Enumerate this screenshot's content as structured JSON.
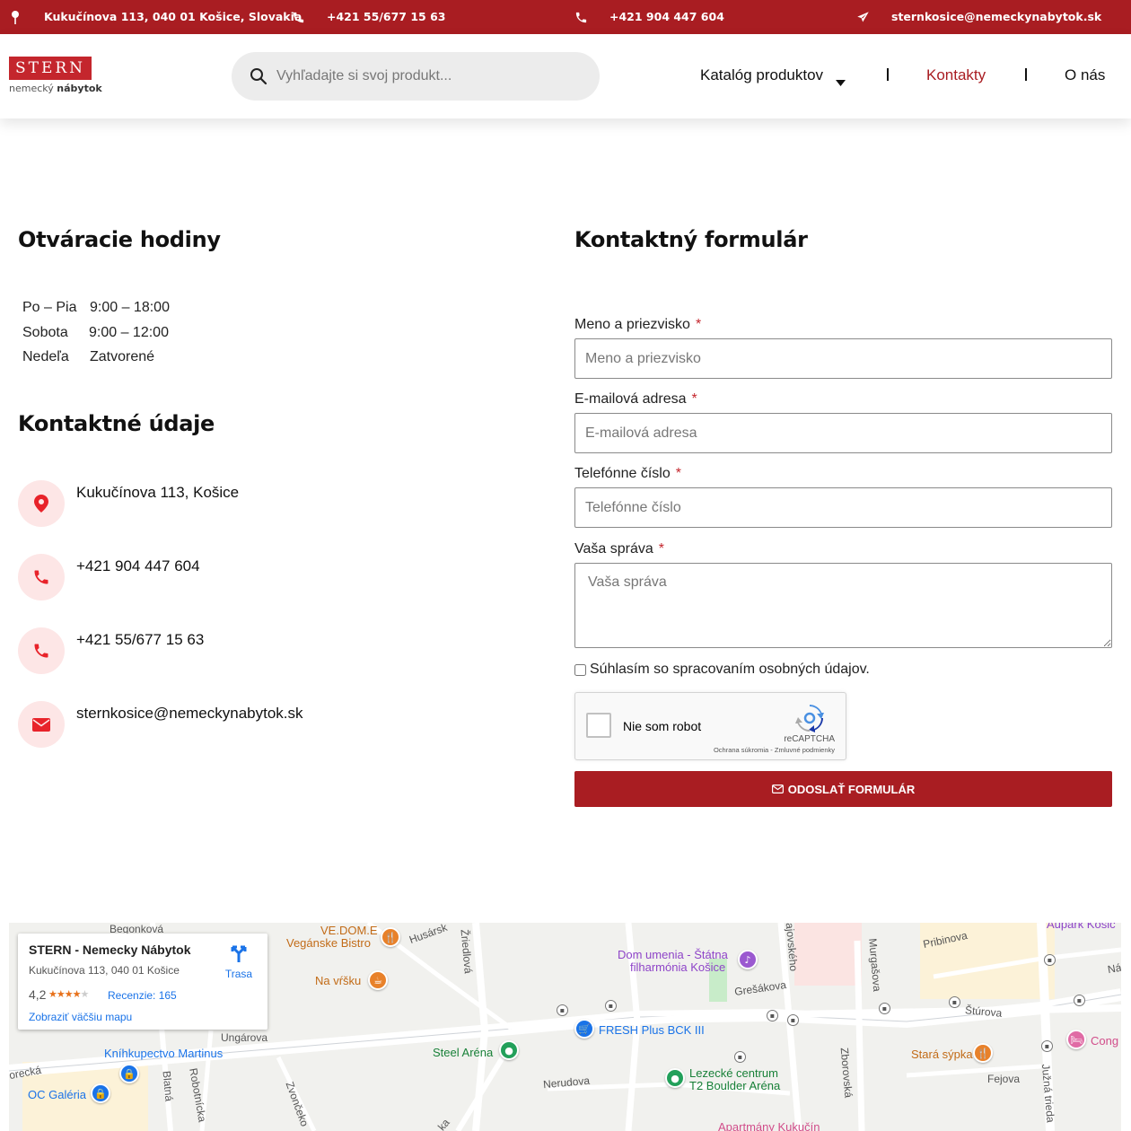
{
  "topbar": {
    "address": "Kukučínova 113, 040 01 Košice, Slovakia",
    "phone1": "+421 55/677 15 63",
    "phone2": "+421 904 447 604",
    "email": "sternkosice@nemeckynabytok.sk"
  },
  "header": {
    "logo_main": "STERN",
    "logo_sub_1": "nemecký",
    "logo_sub_2": "nábytok",
    "search_placeholder": "Vyhľadajte si svoj produkt...",
    "nav": {
      "catalog": "Katalóg produktov",
      "contacts": "Kontakty",
      "about": "O nás",
      "separator": "|"
    }
  },
  "hours": {
    "title": "Otváracie hodiny",
    "rows": [
      {
        "day": "Po – Pia",
        "time": "9:00 – 18:00"
      },
      {
        "day": "Sobota",
        "time": "9:00 – 12:00"
      },
      {
        "day": "Nedeľa",
        "time": "Zatvorené"
      }
    ]
  },
  "contact": {
    "title": "Kontaktné údaje",
    "address": "Kukučínova 113, Košice",
    "phone_mobile": "+421 904 447 604",
    "phone_landline": "+421 55/677 15 63",
    "email": "sternkosice@nemeckynabytok.sk"
  },
  "form": {
    "title": "Kontaktný formulár",
    "required_mark": "*",
    "name_label": "Meno a priezvisko",
    "name_placeholder": "Meno a priezvisko",
    "email_label": "E-mailová adresa",
    "email_placeholder": "E-mailová adresa",
    "phone_label": "Telefónne číslo",
    "phone_placeholder": "Telefónne číslo",
    "message_label": "Vaša správa",
    "message_placeholder": "Vaša správa",
    "consent_label": "Súhlasím so spracovaním osobných údajov.",
    "recaptcha_label": "Nie som robot",
    "recaptcha_brand": "reCAPTCHA",
    "recaptcha_terms": "Ochrana súkromia - Zmluvné podmienky",
    "submit_label": "ODOSLAŤ FORMULÁR"
  },
  "map": {
    "card": {
      "title": "STERN - Nemecky Nábytok",
      "address": "Kukučínova 113, 040 01 Košice",
      "rating": "4,2",
      "stars": 4.2,
      "reviews": "Recenzie: 165",
      "bigger_map": "Zobraziť väčšiu mapu",
      "route": "Trasa"
    },
    "labels": {
      "vedome_1": "VE.DOM.E",
      "vedome_2": "Vegánske Bistro",
      "na_vrsku": "Na vŕšku",
      "dom_umenia_1": "Dom umenia - Štátna",
      "dom_umenia_2": "filharmónia Košice",
      "gresakova": "Grešákova",
      "sturova": "Štúrova",
      "fresh_plus": "FRESH Plus BCK III",
      "steel_arena": "Steel Aréna",
      "lezecke_1": "Lezecké centrum",
      "lezecke_2": "T2 Boulder Aréna",
      "stara_sypka": "Stará sýpka",
      "fejova": "Fejova",
      "nerudova": "Nerudova",
      "knihkupectvo": "Kníhkupectvo Martinus",
      "oc_galeria": "OC Galéria",
      "ungarova": "Ungárova",
      "ziedlova": "Žriedlová",
      "murgasova": "Murgašova",
      "pribinova": "Pribinova",
      "zborovska": "Zborovská",
      "juzna_trieda": "Južná trieda",
      "blatna": "Blatná",
      "robotnicka": "Robotnícka",
      "zvoncekova": "Zvončeko",
      "cong": "Cong",
      "aupark": "Aupark Košic",
      "apartmany": "Apartmány Kukučín",
      "husarska": "Husársk",
      "orecka": "orecká",
      "ajovskeho": "ajovského",
      "begonkova": "Begonková",
      "na_edge": "Ná",
      "ka_edge": "ka"
    }
  },
  "colors": {
    "brand_red": "#a91d22",
    "logo_red": "#c4262d",
    "icon_bg": "#fde6e6",
    "icon_red": "#e8232a",
    "map_link_blue": "#1a73e8"
  },
  "icons": {
    "address": "map-pin-icon",
    "phone": "phone-icon",
    "email": "envelope-icon",
    "send": "paper-plane-icon",
    "search": "search-icon",
    "dropdown": "caret-down-icon",
    "route": "directions-icon"
  }
}
